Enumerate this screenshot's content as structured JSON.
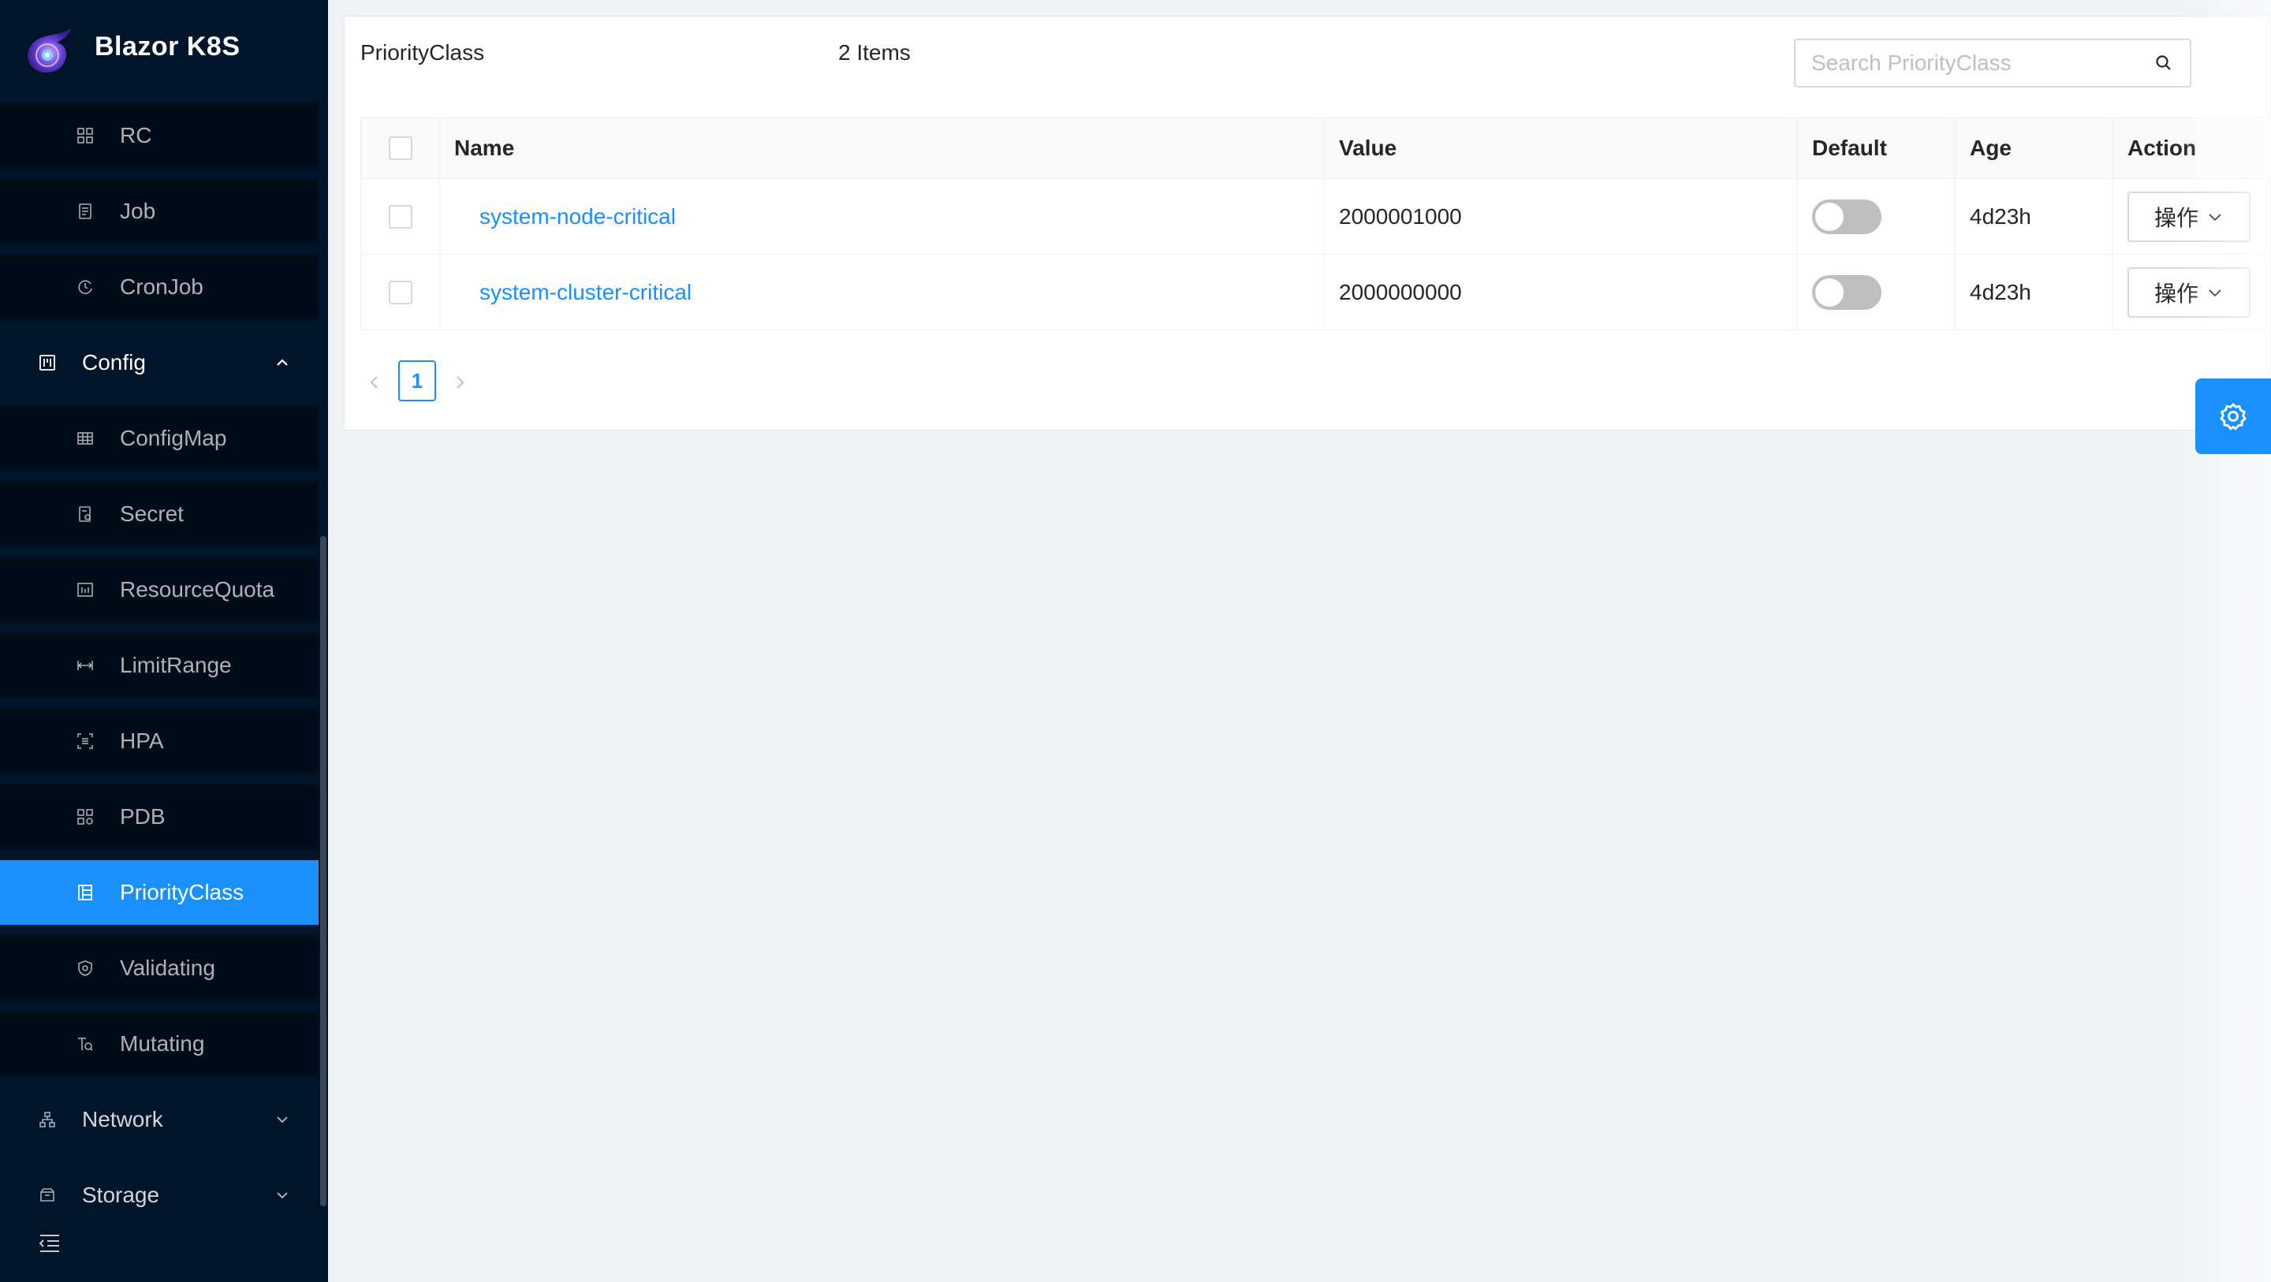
{
  "brand": {
    "title": "Blazor K8S"
  },
  "sidebar": {
    "items": [
      {
        "label": "RC",
        "icon": "cluster-icon",
        "kind": "sub"
      },
      {
        "label": "Job",
        "icon": "file-icon",
        "kind": "sub"
      },
      {
        "label": "CronJob",
        "icon": "clock-icon",
        "kind": "sub"
      },
      {
        "label": "Config",
        "icon": "config-icon",
        "kind": "top",
        "expanded": true
      },
      {
        "label": "ConfigMap",
        "icon": "table-icon",
        "kind": "sub"
      },
      {
        "label": "Secret",
        "icon": "secret-file-icon",
        "kind": "sub"
      },
      {
        "label": "ResourceQuota",
        "icon": "quota-icon",
        "kind": "sub"
      },
      {
        "label": "LimitRange",
        "icon": "range-icon",
        "kind": "sub"
      },
      {
        "label": "HPA",
        "icon": "scale-icon",
        "kind": "sub"
      },
      {
        "label": "PDB",
        "icon": "pdb-icon",
        "kind": "sub"
      },
      {
        "label": "PriorityClass",
        "icon": "priority-icon",
        "kind": "sub",
        "active": true
      },
      {
        "label": "Validating",
        "icon": "shield-icon",
        "kind": "sub"
      },
      {
        "label": "Mutating",
        "icon": "mutate-icon",
        "kind": "sub"
      },
      {
        "label": "Network",
        "icon": "network-icon",
        "kind": "top",
        "expanded": false
      },
      {
        "label": "Storage",
        "icon": "storage-icon",
        "kind": "top",
        "expanded": false
      }
    ]
  },
  "header": {
    "title": "PriorityClass",
    "count": "2 Items",
    "search_placeholder": "Search PriorityClass"
  },
  "table": {
    "columns": [
      "Name",
      "Value",
      "Default",
      "Age",
      "Action"
    ],
    "rows": [
      {
        "name": "system-node-critical",
        "value": "2000001000",
        "default": false,
        "age": "4d23h",
        "action": "操作"
      },
      {
        "name": "system-cluster-critical",
        "value": "2000000000",
        "default": false,
        "age": "4d23h",
        "action": "操作"
      }
    ]
  },
  "pagination": {
    "current": "1"
  },
  "colors": {
    "primary": "#1890ff",
    "sidebar_bg": "#001529",
    "submenu_bg": "#000c17"
  }
}
